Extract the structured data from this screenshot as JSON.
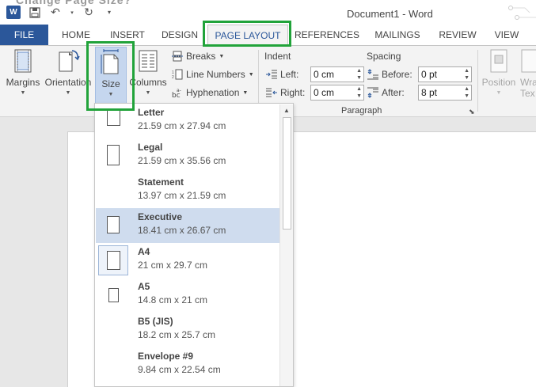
{
  "titlebar": {
    "title": "Document1 - Word",
    "cut_text": "Change Page Size?"
  },
  "tabs": [
    "FILE",
    "HOME",
    "INSERT",
    "DESIGN",
    "PAGE LAYOUT",
    "REFERENCES",
    "MAILINGS",
    "REVIEW",
    "VIEW"
  ],
  "ribbon": {
    "margins_label": "Margins",
    "orientation_label": "Orientation",
    "size_label": "Size",
    "columns_label": "Columns",
    "breaks_label": "Breaks",
    "line_numbers_label": "Line Numbers",
    "hyphenation_label": "Hyphenation",
    "indent_title": "Indent",
    "spacing_title": "Spacing",
    "left_label": "Left:",
    "right_label": "Right:",
    "before_label": "Before:",
    "after_label": "After:",
    "left_value": "0 cm",
    "right_value": "0 cm",
    "before_value": "0 pt",
    "after_value": "8 pt",
    "paragraph_title": "Paragraph",
    "position_label": "Position",
    "wrap_label": "Wra",
    "text_label": "Tex"
  },
  "sizes": [
    {
      "name": "Letter",
      "dims": "21.59 cm x 27.94 cm"
    },
    {
      "name": "Legal",
      "dims": "21.59 cm x 35.56 cm"
    },
    {
      "name": "Statement",
      "dims": "13.97 cm x 21.59 cm"
    },
    {
      "name": "Executive",
      "dims": "18.41 cm x 26.67 cm"
    },
    {
      "name": "A4",
      "dims": "21 cm x 29.7 cm"
    },
    {
      "name": "A5",
      "dims": "14.8 cm x 21 cm"
    },
    {
      "name": "B5 (JIS)",
      "dims": "18.2 cm x 25.7 cm"
    },
    {
      "name": "Envelope #9",
      "dims": "9.84 cm x 22.54 cm"
    }
  ],
  "colors": {
    "brand": "#2b579a",
    "highlight": "#21a33a",
    "selected_item": "#cfdcee"
  }
}
